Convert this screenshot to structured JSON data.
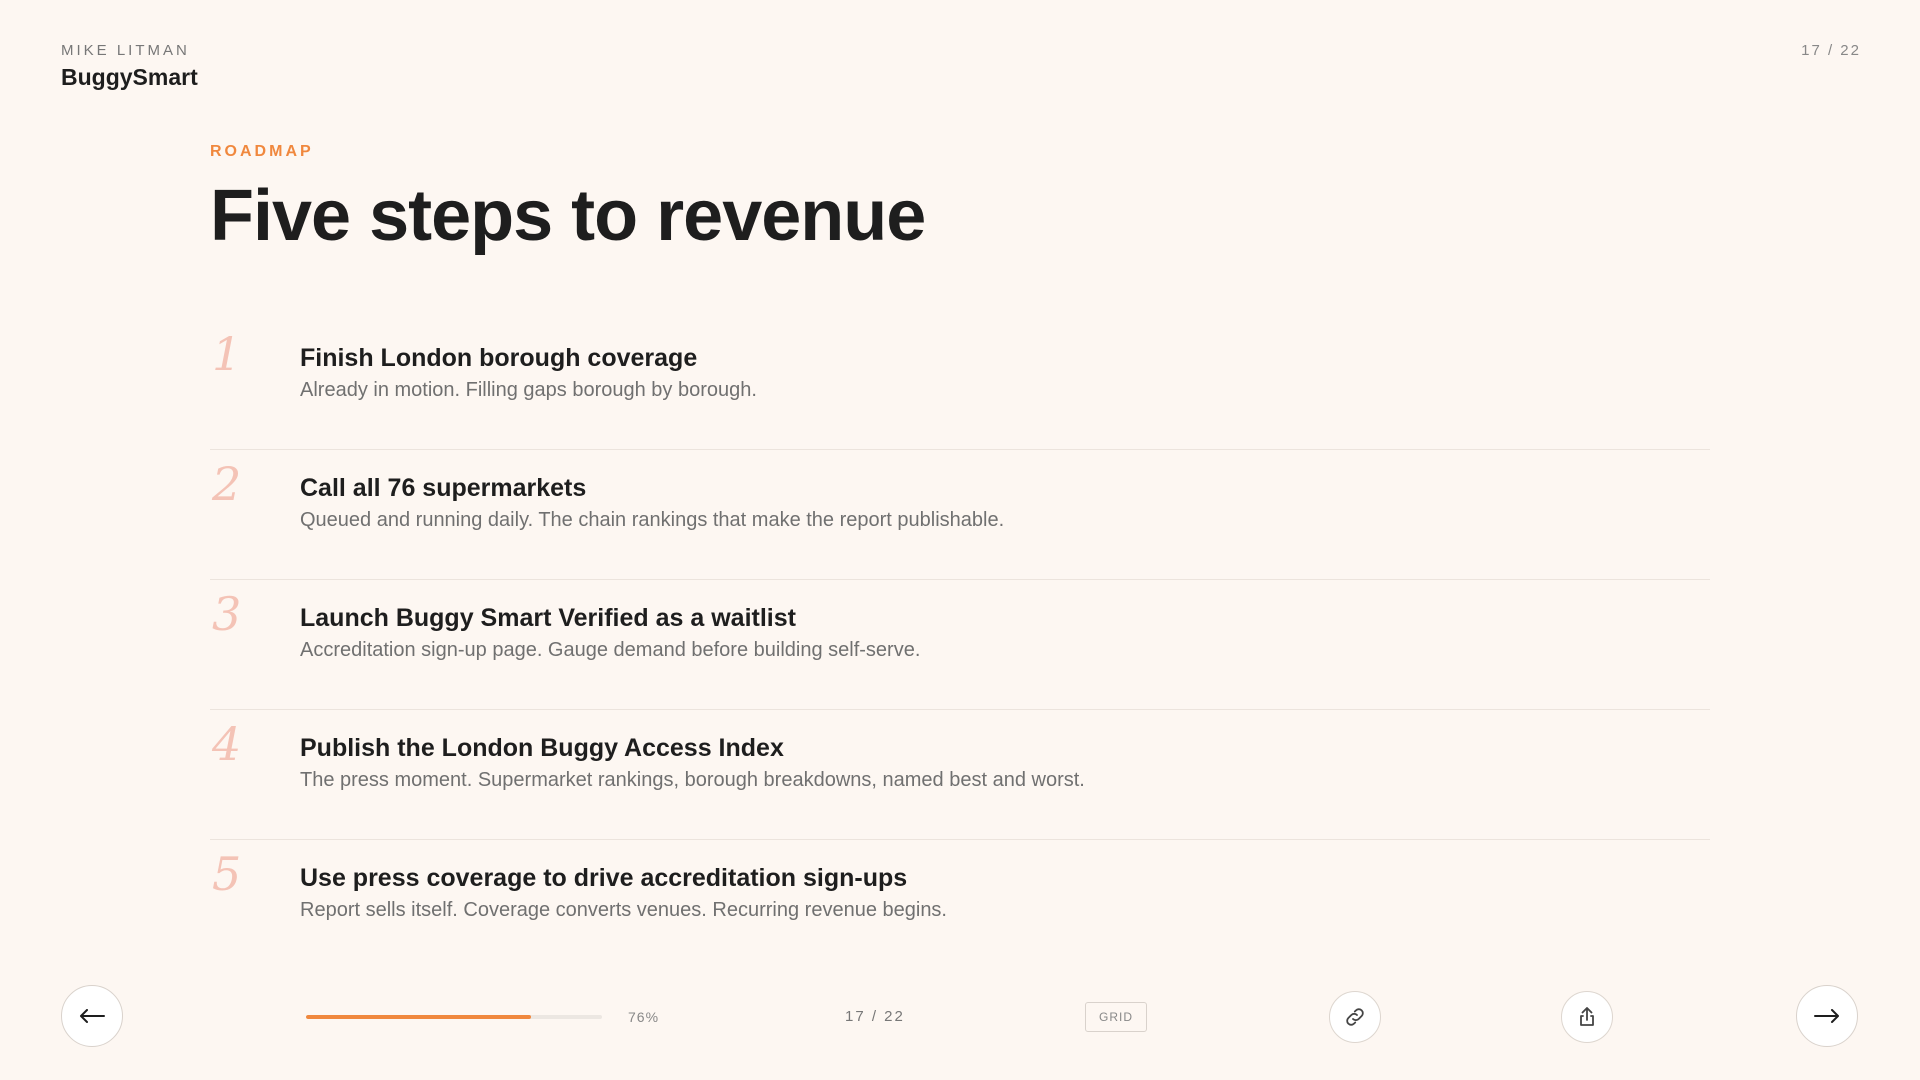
{
  "header": {
    "author": "MIKE LITMAN",
    "brand": "BuggySmart",
    "page_indicator": "17 / 22"
  },
  "slide": {
    "eyebrow": "ROADMAP",
    "title": "Five steps to revenue",
    "steps": [
      {
        "number": "1",
        "title": "Finish London borough coverage",
        "description": "Already in motion. Filling gaps borough by borough."
      },
      {
        "number": "2",
        "title": "Call all 76 supermarkets",
        "description": "Queued and running daily. The chain rankings that make the report publishable."
      },
      {
        "number": "3",
        "title": "Launch Buggy Smart Verified as a waitlist",
        "description": "Accreditation sign-up page. Gauge demand before building self-serve."
      },
      {
        "number": "4",
        "title": "Publish the London Buggy Access Index",
        "description": "The press moment. Supermarket rankings, borough breakdowns, named best and worst."
      },
      {
        "number": "5",
        "title": "Use press coverage to drive accreditation sign-ups",
        "description": "Report sells itself. Coverage converts venues. Recurring revenue begins."
      }
    ]
  },
  "footer": {
    "prev_icon": "arrow-left-icon",
    "next_icon": "arrow-right-icon",
    "progress_percent": 76,
    "progress_label": "76%",
    "page_indicator": "17 / 22",
    "grid_label": "GRID",
    "link_icon": "link-icon",
    "share_icon": "share-icon"
  },
  "colors": {
    "background": "#fdf7f2",
    "accent": "#f0883e",
    "step_number": "#f4c3b6",
    "text_primary": "#1e1e1e",
    "text_secondary": "#707070"
  }
}
